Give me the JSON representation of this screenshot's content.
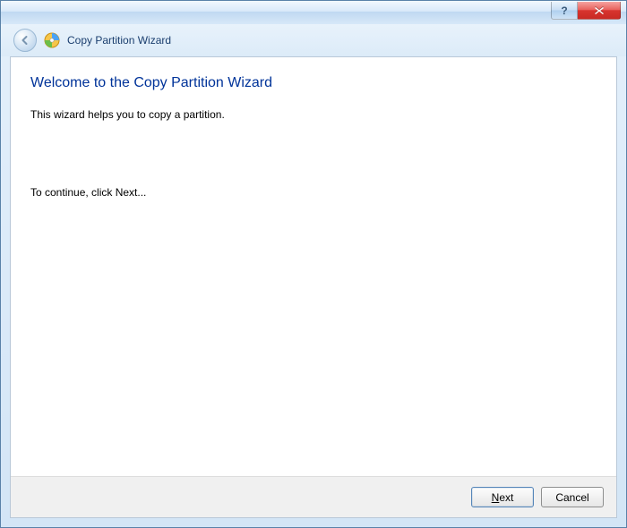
{
  "titlebar": {
    "help_label": "?",
    "close_label": "Close"
  },
  "header": {
    "title": "Copy Partition Wizard"
  },
  "main": {
    "heading": "Welcome to the Copy Partition Wizard",
    "intro": "This wizard helps you to copy a partition.",
    "continue": "To continue, click Next..."
  },
  "footer": {
    "next_prefix": "N",
    "next_rest": "ext",
    "cancel": "Cancel"
  }
}
